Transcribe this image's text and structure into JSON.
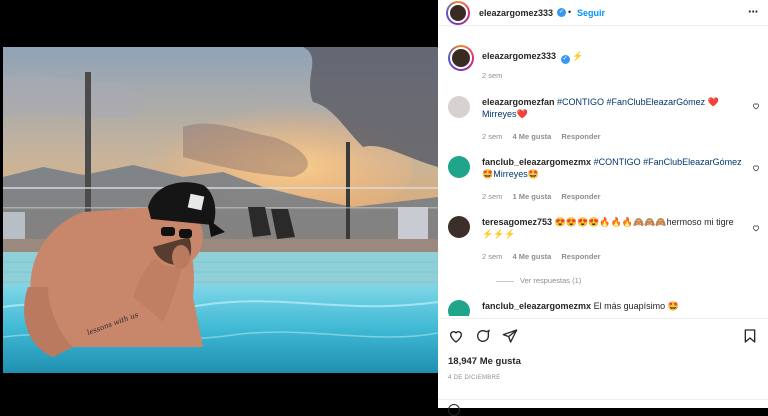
{
  "header": {
    "username": "eleazargomez333",
    "separator": "•",
    "follow_label": "Seguir",
    "more_icon": "more-horizontal-icon"
  },
  "caption": {
    "username": "eleazargomez333",
    "text": "⚡",
    "time": "2 sem"
  },
  "comments": [
    {
      "username": "eleazargomezfan",
      "text": "#CONTIGO #FanClubEleazarGómez ❤️ Mirreyes❤️",
      "time": "2 sem",
      "likes": "4 Me gusta",
      "reply": "Responder"
    },
    {
      "username": "fanclub_eleazargomezmx",
      "text": "#CONTIGO #FanClubEleazarGómez 🤩Mirreyes🤩",
      "time": "2 sem",
      "likes": "1 Me gusta",
      "reply": "Responder"
    },
    {
      "username": "teresagomez753",
      "text": "😍😍😍😍🔥🔥🔥🙈🙈🙈hermoso mi tigre ⚡⚡⚡",
      "time": "2 sem",
      "likes": "4 Me gusta",
      "reply": "Responder",
      "view_replies": "Ver respuestas (1)"
    },
    {
      "username": "fanclub_eleazargomezmx",
      "text": "El más guapísimo 🤩"
    }
  ],
  "actions": {
    "likes": "18,947 Me gusta",
    "date": "4 DE DICIEMBRE"
  },
  "colors": {
    "accent": "#0095f6",
    "verified": "#3897f0",
    "heart": "#ed4956",
    "muted": "#8e8e8e"
  }
}
